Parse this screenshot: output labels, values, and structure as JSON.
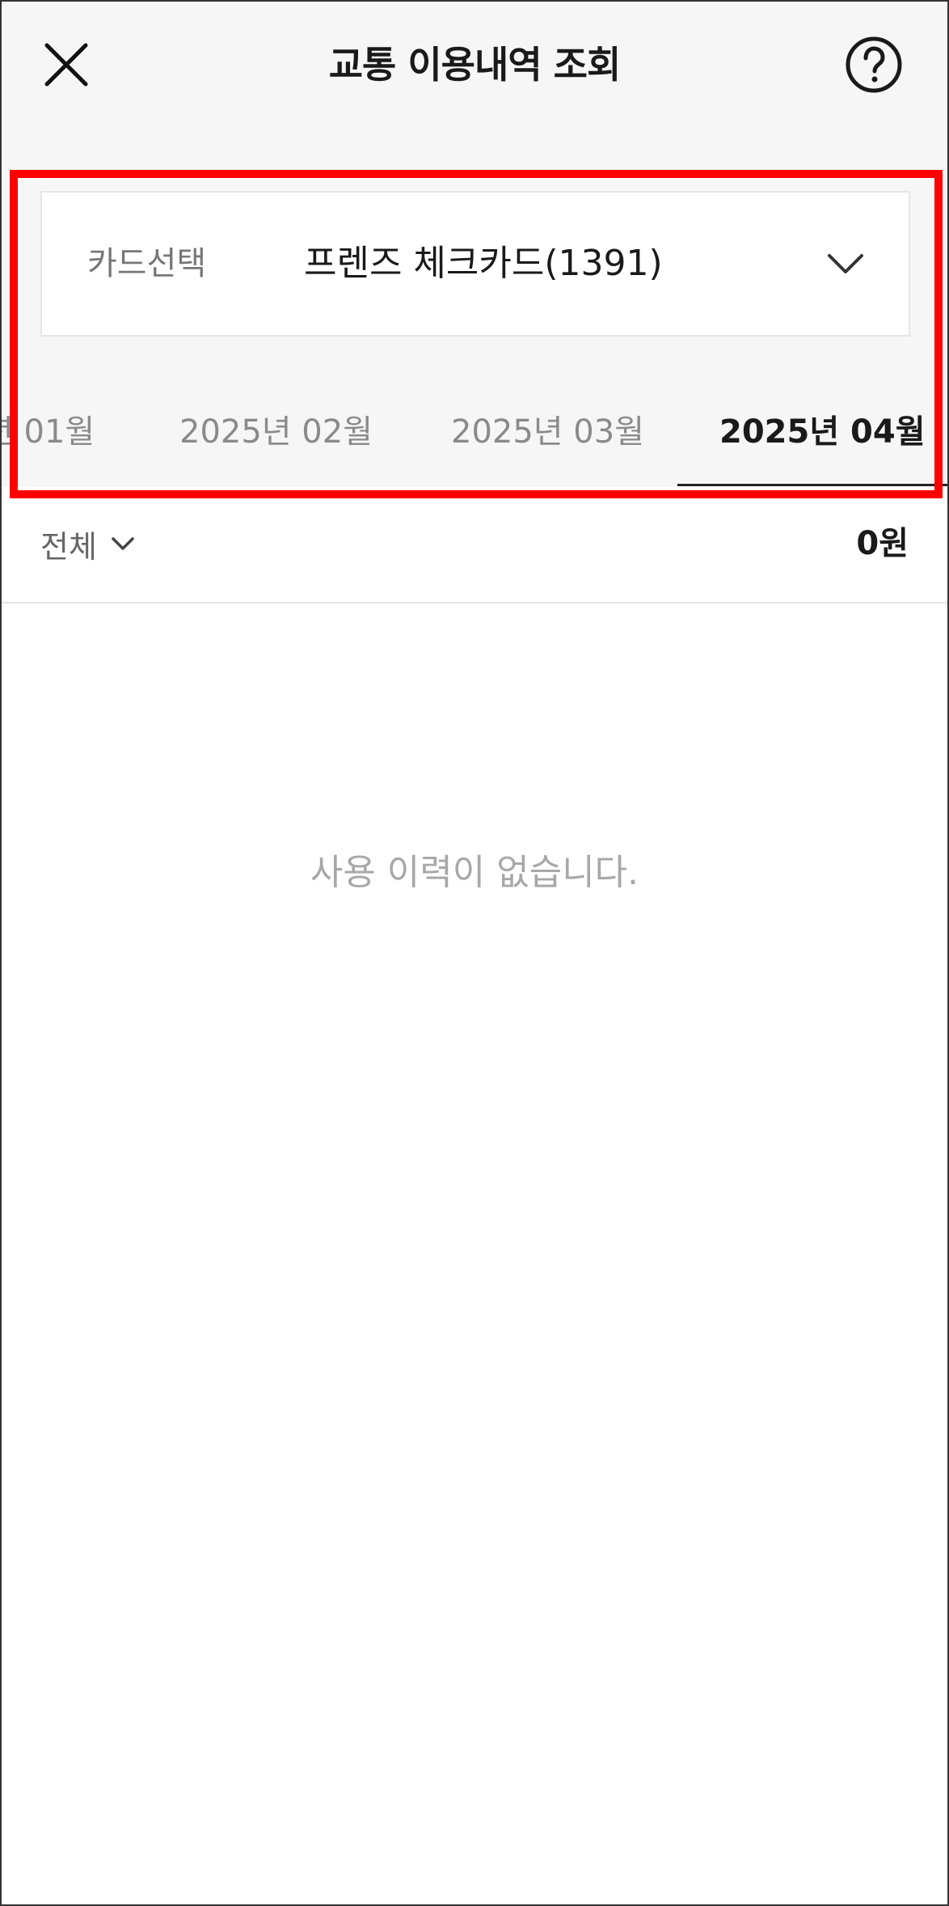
{
  "header": {
    "title": "교통 이용내역 조회",
    "close_icon": "close-icon",
    "help_icon": "help-icon"
  },
  "card_select": {
    "label": "카드선택",
    "value": "프렌즈 체크카드(1391)",
    "icon": "chevron-down-icon"
  },
  "month_tabs": [
    {
      "label": "년 01월",
      "selected": false
    },
    {
      "label": "2025년 02월",
      "selected": false
    },
    {
      "label": "2025년 03월",
      "selected": false
    },
    {
      "label": "2025년 04월",
      "selected": true
    }
  ],
  "filter": {
    "label": "전체",
    "icon": "chevron-down-icon",
    "total": "0원"
  },
  "empty_message": "사용 이력이 없습니다.",
  "colors": {
    "header_bg": "#f6f6f6",
    "highlight": "#ff0000",
    "text_dark": "#1a1a1a",
    "text_muted": "#8a8a8a",
    "empty_text": "#a8a8a8"
  }
}
